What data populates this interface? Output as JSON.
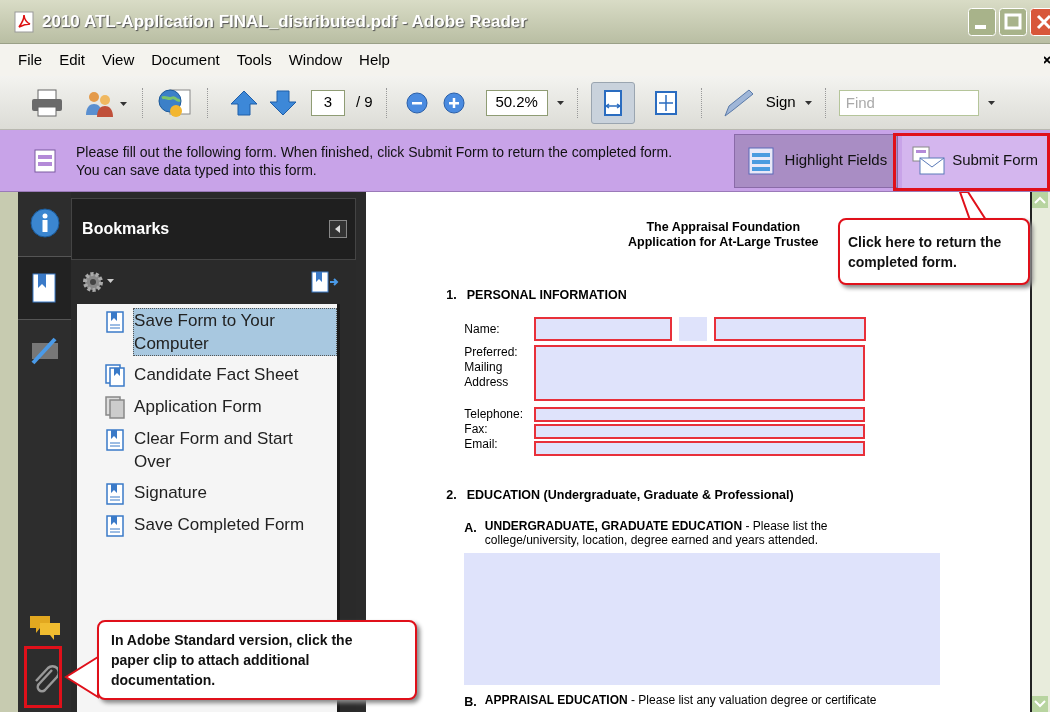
{
  "window": {
    "title": "2010 ATL-Application FINAL_distributed.pdf - Adobe Reader"
  },
  "menu": [
    "File",
    "Edit",
    "View",
    "Document",
    "Tools",
    "Window",
    "Help"
  ],
  "toolbar": {
    "page_number": "3",
    "page_total": "/ 9",
    "zoom": "50.2%",
    "sign": "Sign",
    "find": {
      "placeholder": "Find"
    },
    "view_modes": [
      {
        "kind": "fit-width",
        "selected": true
      },
      {
        "kind": "fit-page",
        "selected": false
      }
    ]
  },
  "form_bar": {
    "message": "Please fill out the following form. When finished, click Submit Form to return the completed form. You can save data typed into this form.",
    "buttons": [
      {
        "label": "Highlight Fields",
        "kind": "highlight",
        "selected": true
      },
      {
        "label": "Submit Form",
        "kind": "submit",
        "selected": false
      }
    ]
  },
  "nav_tabs": [
    {
      "kind": "info",
      "selected": false
    },
    {
      "kind": "bookmarks",
      "selected": true
    },
    {
      "kind": "signatures",
      "selected": false
    }
  ],
  "bookmarks": {
    "title": "Bookmarks",
    "items": [
      {
        "label": "Save Form to Your Computer",
        "kind": "page",
        "selected": true
      },
      {
        "label": "Candidate Fact Sheet",
        "kind": "pages",
        "selected": false
      },
      {
        "label": "Application Form",
        "kind": "grey",
        "selected": false
      },
      {
        "label": "Clear Form and Start Over",
        "kind": "page",
        "selected": false
      },
      {
        "label": "Signature",
        "kind": "page",
        "selected": false
      },
      {
        "label": "Save Completed Form",
        "kind": "page",
        "selected": false
      }
    ]
  },
  "document": {
    "heading": [
      "The Appraisal Foundation",
      "Application for At-Large Trustee"
    ],
    "sections": [
      {
        "number": "1.",
        "title": "PERSONAL INFORMATION"
      },
      {
        "number": "2.",
        "title": "EDUCATION (Undergraduate, Graduate & Professional)"
      }
    ],
    "personal": {
      "name_label": "Name:",
      "address_label": [
        "Preferred:",
        "Mailing",
        "Address"
      ],
      "contact_labels": [
        "Telephone:",
        "Fax:",
        "Email:"
      ]
    },
    "subsections": [
      {
        "letter": "A.",
        "text": "**UNDERGRADUATE, GRADUATE EDUCATION** - Please list the college/university, location, degree earned and years attended."
      },
      {
        "letter": "B.",
        "text": "**APPRAISAL EDUCATION** - Please list any valuation degree or certificate"
      }
    ]
  },
  "callouts": [
    {
      "text": "Click here to return the completed form."
    },
    {
      "text": "In Adobe Standard version, click the paper clip to attach additional documentation."
    }
  ]
}
